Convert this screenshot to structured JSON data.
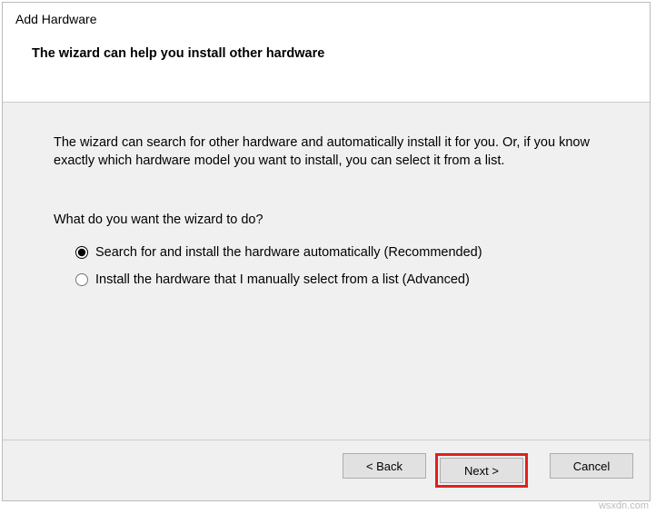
{
  "header": {
    "window_title": "Add Hardware",
    "subtitle": "The wizard can help you install other hardware"
  },
  "body": {
    "intro": "The wizard can search for other hardware and automatically install it for you. Or, if you know exactly which hardware model you want to install, you can select it from a list.",
    "question": "What do you want the wizard to do?",
    "options": {
      "auto": "Search for and install the hardware automatically (Recommended)",
      "manual": "Install the hardware that I manually select from a list (Advanced)"
    }
  },
  "footer": {
    "back": "< Back",
    "next": "Next >",
    "cancel": "Cancel"
  },
  "watermark": "wsxdn.com"
}
